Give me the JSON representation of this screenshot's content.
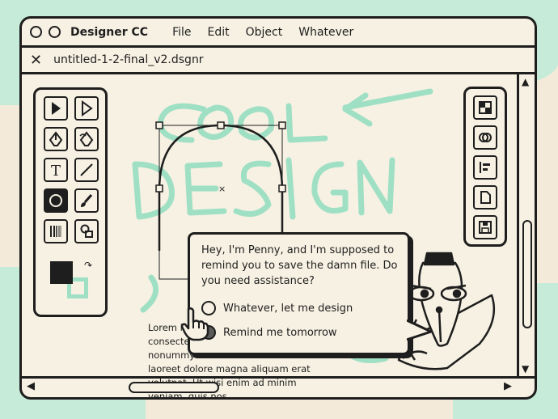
{
  "colors": {
    "outline": "#1e1e1e",
    "paper": "#f7f1e3",
    "background": "#f3ead9",
    "mint": "#c6ecd9",
    "scribble": "#9fe0c4"
  },
  "titlebar": {
    "app_name": "Designer CC",
    "menu": [
      "File",
      "Edit",
      "Object",
      "Whatever"
    ]
  },
  "tab": {
    "filename": "untitled-1-2-final_v2.dsgnr"
  },
  "toolbox": {
    "tools": [
      "selection-arrow-icon",
      "direct-select-icon",
      "pen-icon",
      "curvature-pen-icon",
      "type-icon",
      "line-icon",
      "ellipse-icon",
      "brush-icon",
      "gradient-icon",
      "shape-builder-icon"
    ],
    "active_tool": "ellipse-icon"
  },
  "right_panel": {
    "icons": [
      "layers-icon",
      "pathfinder-icon",
      "align-icon",
      "document-icon",
      "save-icon"
    ]
  },
  "canvas": {
    "scribble_text": [
      "COOL",
      "DESIGN"
    ],
    "lorem": "Lorem ipsum dolor sit amet, consectetuer adipiscing elit, sed diam nonummy nibh euismod tincidunt ut laoreet dolore magna aliquam erat volutpat. Ut wisi enim ad minim veniam, quis nos"
  },
  "assistant": {
    "message": "Hey, I'm Penny, and I'm supposed to remind you to save the damn file. Do you need assistance?",
    "options": [
      {
        "label": "Whatever, let me design",
        "selected": false
      },
      {
        "label": "Remind me tomorrow",
        "selected": true
      }
    ]
  }
}
